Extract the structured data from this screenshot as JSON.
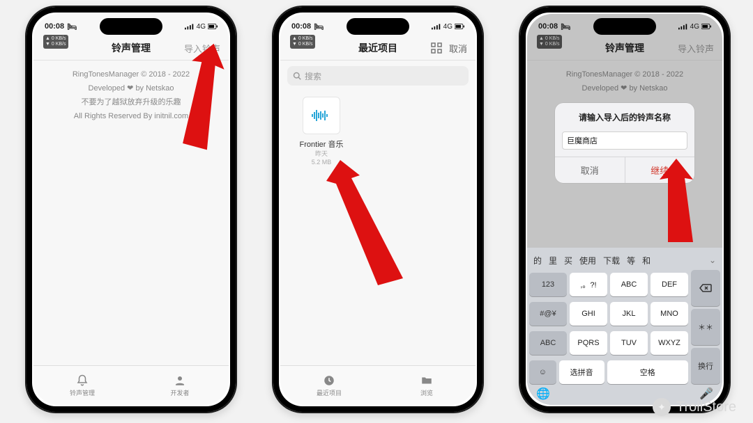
{
  "status": {
    "time": "00:08",
    "net": "4G",
    "kb_badge": "▲ 0 KB/s\n▼ 0 KB/s"
  },
  "phone1": {
    "title": "铃声管理",
    "import": "导入铃声",
    "lines": [
      "RingTonesManager © 2018 - 2022",
      "Developed ❤ by Netskao",
      "不要为了越狱放弃升级的乐趣",
      "All Rights Reserved By initnil.com"
    ],
    "tab1": "铃声管理",
    "tab2": "开发者"
  },
  "phone2": {
    "title": "最近项目",
    "cancel": "取消",
    "search_ph": "搜索",
    "file_name": "Frontier 音乐",
    "file_date": "昨天",
    "file_size": "5.2 MB",
    "tab1": "最近项目",
    "tab2": "浏览"
  },
  "phone3": {
    "title": "铃声管理",
    "import": "导入铃声",
    "lines": [
      "RingTonesManager © 2018 - 2022",
      "Developed ❤ by Netskao"
    ],
    "alert_title": "请输入导入后的铃声名称",
    "alert_value": "巨魔商店",
    "alert_cancel": "取消",
    "alert_ok": "继续",
    "candidates": [
      "的",
      "里",
      "买",
      "使用",
      "下载",
      "等",
      "和"
    ],
    "keys": {
      "k123": "123",
      "kpunct": ",。?!",
      "kabc1": "ABC",
      "kdef": "DEF",
      "ksym": "#@¥",
      "kghi": "GHI",
      "kjkl": "JKL",
      "kmno": "MNO",
      "kabc2": "ABC",
      "kpqrs": "PQRS",
      "ktuv": "TUV",
      "kwxyz": "WXYZ",
      "kpinyin": "选拼音",
      "kspace": "空格",
      "kenter": "换行"
    }
  },
  "watermark": "TrollStore"
}
